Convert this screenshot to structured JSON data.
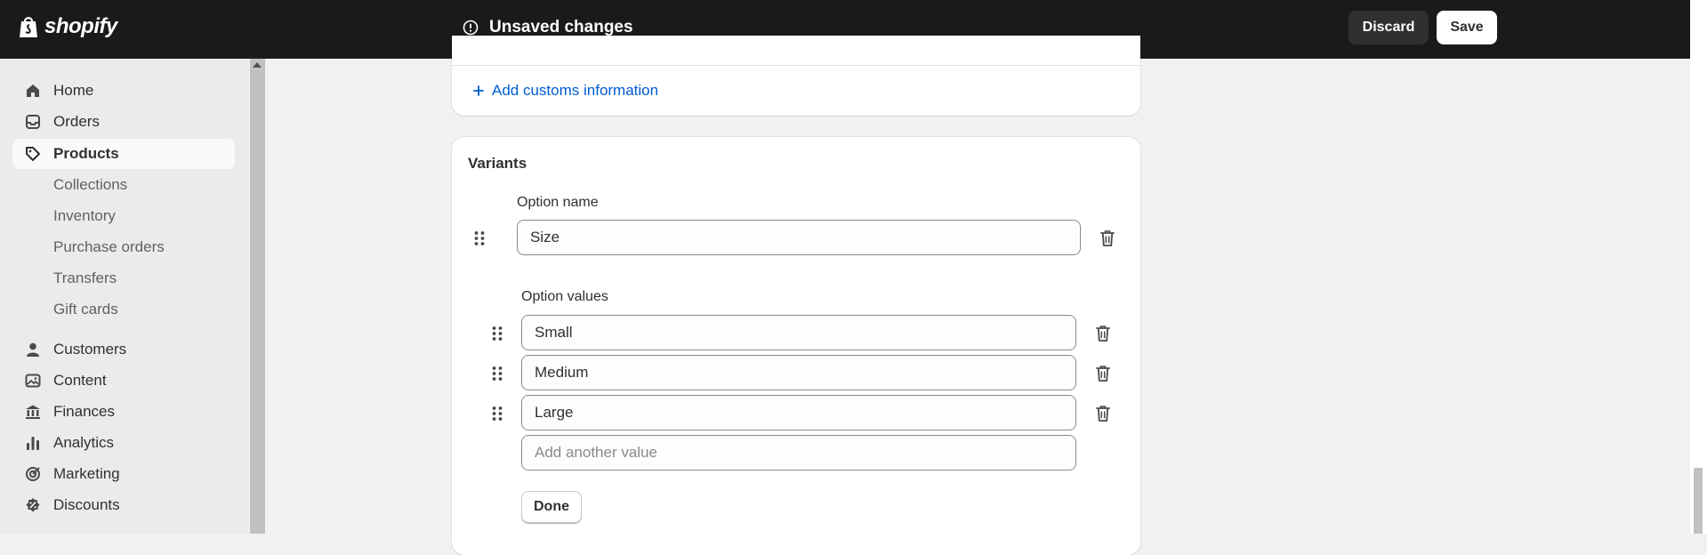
{
  "topbar": {
    "logo_text": "shopify",
    "unsaved_text": "Unsaved changes",
    "discard_label": "Discard",
    "save_label": "Save"
  },
  "sidebar": {
    "items": [
      {
        "label": "Home",
        "icon": "home-icon"
      },
      {
        "label": "Orders",
        "icon": "inbox-icon"
      },
      {
        "label": "Products",
        "icon": "tag-icon",
        "active": true
      },
      {
        "label": "Customers",
        "icon": "person-icon"
      },
      {
        "label": "Content",
        "icon": "image-icon"
      },
      {
        "label": "Finances",
        "icon": "bank-icon"
      },
      {
        "label": "Analytics",
        "icon": "bar-chart-icon"
      },
      {
        "label": "Marketing",
        "icon": "target-icon"
      },
      {
        "label": "Discounts",
        "icon": "discount-icon"
      }
    ],
    "product_subitems": [
      "Collections",
      "Inventory",
      "Purchase orders",
      "Transfers",
      "Gift cards"
    ]
  },
  "customs": {
    "link_label": "Add customs information"
  },
  "variants": {
    "title": "Variants",
    "option_name_label": "Option name",
    "option_name_value": "Size",
    "option_values_label": "Option values",
    "values": [
      "Small",
      "Medium",
      "Large"
    ],
    "new_value_placeholder": "Add another value",
    "done_label": "Done"
  },
  "colors": {
    "topbar_bg": "#1a1a1a",
    "link": "#005bd3",
    "page_bg": "#f1f1f1"
  }
}
